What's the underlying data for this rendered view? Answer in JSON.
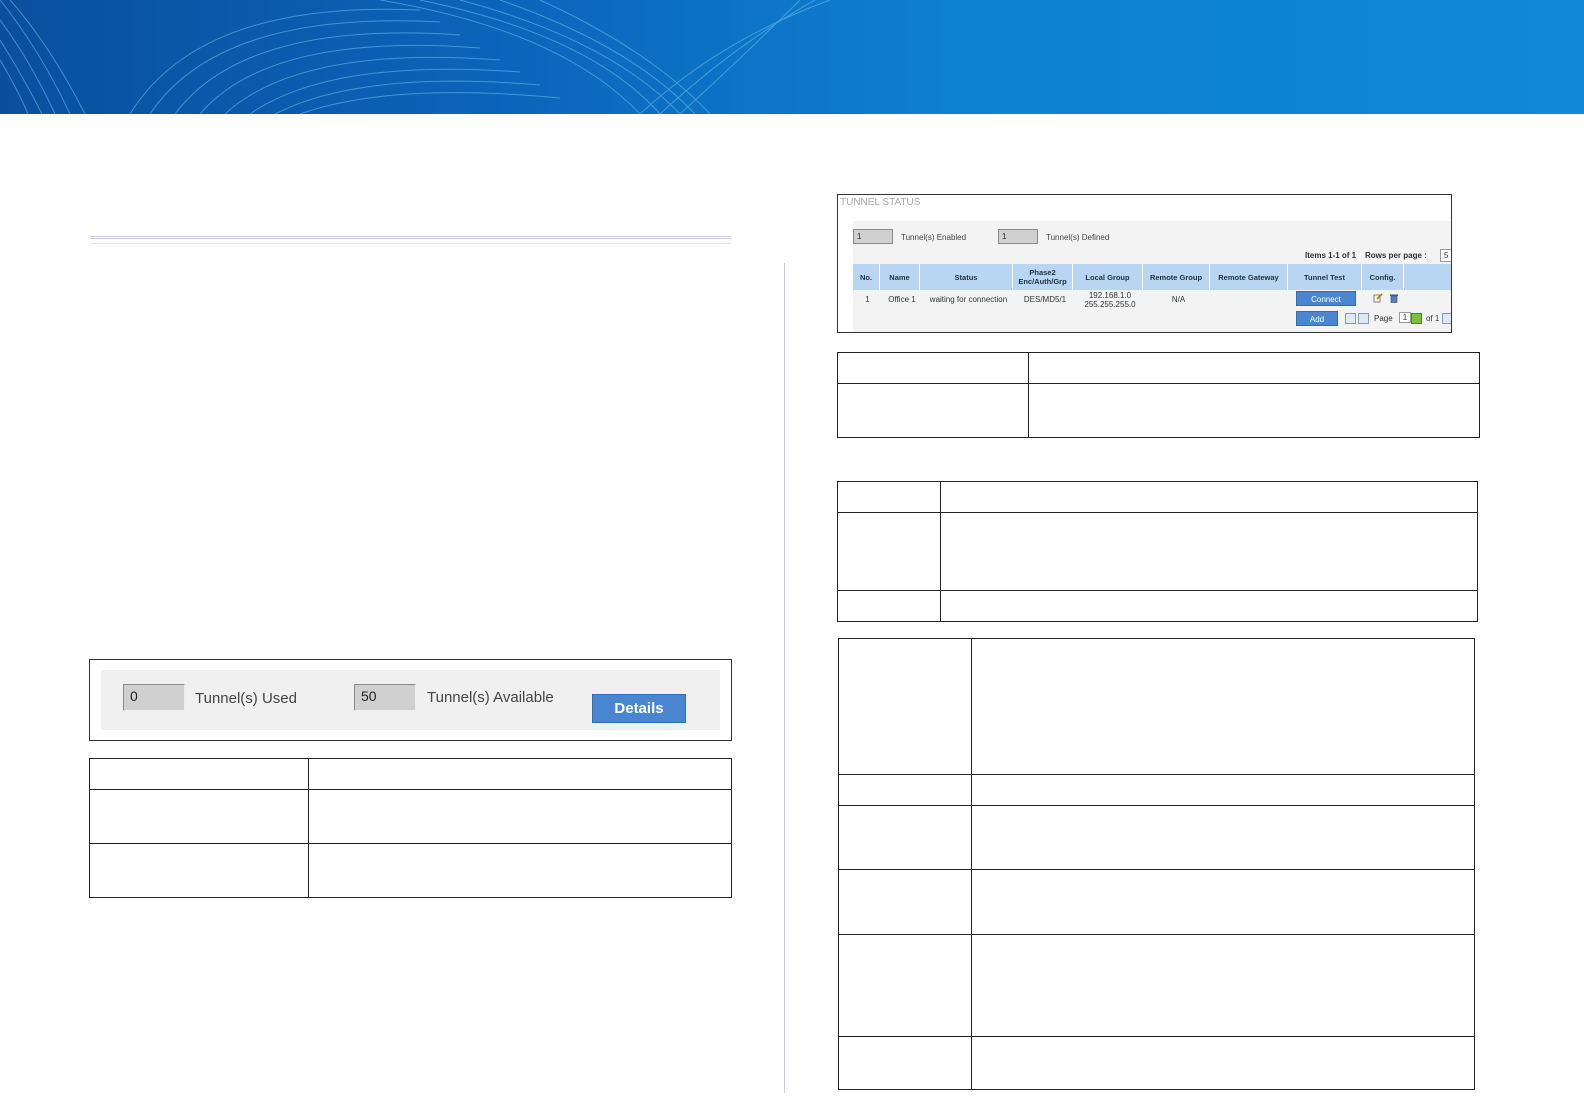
{
  "left": {
    "tunnel_widget": {
      "used_value": "0",
      "used_label": "Tunnel(s) Used",
      "available_value": "50",
      "available_label": "Tunnel(s) Available",
      "details_label": "Details"
    }
  },
  "right": {
    "tunnel_status": {
      "title": "TUNNEL STATUS",
      "enabled_value": "1",
      "enabled_label": "Tunnel(s) Enabled",
      "defined_value": "1",
      "defined_label": "Tunnel(s) Defined",
      "items_text": "Items 1-1 of 1",
      "rows_per_page_label": "Rows per page :",
      "rows_per_page_value": "5",
      "columns": [
        "No.",
        "Name",
        "Status",
        "Phase2 Enc/Auth/Grp",
        "Local Group",
        "Remote Group",
        "Remote Gateway",
        "Tunnel Test",
        "Config."
      ],
      "row": {
        "no": "1",
        "name": "Office 1",
        "status": "waiting for connection",
        "phase2": "DES/MD5/1",
        "local_group_line1": "192.168.1.0",
        "local_group_line2": "255.255.255.0",
        "remote_group": "N/A",
        "remote_gateway": ""
      },
      "connect_label": "Connect",
      "add_label": "Add",
      "page_label": "Page",
      "page_value": "1",
      "of_label": "of 1"
    }
  },
  "colors": {
    "banner": "#0b63b8",
    "button": "#4a86cf",
    "table_header": "#b8d6f2"
  }
}
